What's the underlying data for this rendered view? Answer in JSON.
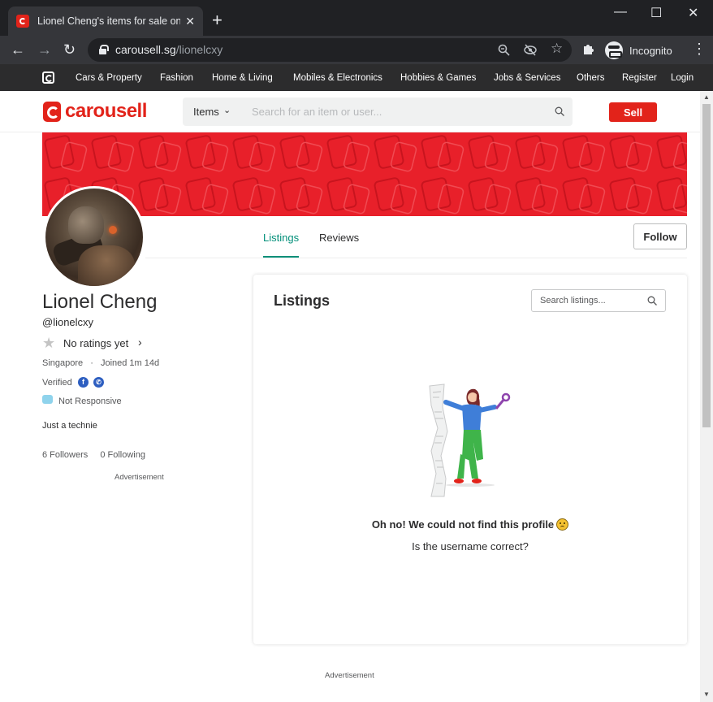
{
  "browser": {
    "tab_title": "Lionel Cheng's items for sale on Carousell",
    "url_host": "carousell.sg",
    "url_path": "/lionelcxy",
    "profile_label": "Incognito",
    "controls": {
      "minimize": "—",
      "maximize": "☐",
      "close": "✕",
      "new_tab": "+"
    }
  },
  "category_nav": {
    "items": [
      "Cars & Property",
      "Fashion",
      "Home & Living",
      "Mobiles & Electronics",
      "Hobbies & Games",
      "Jobs & Services",
      "Others",
      "Register",
      "Login"
    ]
  },
  "header": {
    "logo_text": "carousell",
    "search_category": "Items",
    "search_placeholder": "Search for an item or user...",
    "sell_label": "Sell",
    "brand_color": "#e2231a"
  },
  "profile": {
    "name": "Lionel Cheng",
    "handle": "@lionelcxy",
    "rating": "No ratings yet",
    "location": "Singapore",
    "joined": "Joined 1m 14d",
    "verified_label": "Verified",
    "verified_badges": [
      "facebook-icon",
      "phone-icon"
    ],
    "responsiveness": "Not Responsive",
    "bio": "Just a technie",
    "followers": "6 Followers",
    "following": "0 Following",
    "advertisement_label": "Advertisement",
    "follow_label": "Follow"
  },
  "tabs": [
    {
      "label": "Listings",
      "active": true
    },
    {
      "label": "Reviews",
      "active": false
    }
  ],
  "listings": {
    "title": "Listings",
    "search_placeholder": "Search listings...",
    "empty_title": "Oh no! We could not find this profile",
    "empty_subtitle": "Is the username correct?",
    "accent_color": "#008f79"
  },
  "footer": {
    "advertisement_label": "Advertisement"
  }
}
